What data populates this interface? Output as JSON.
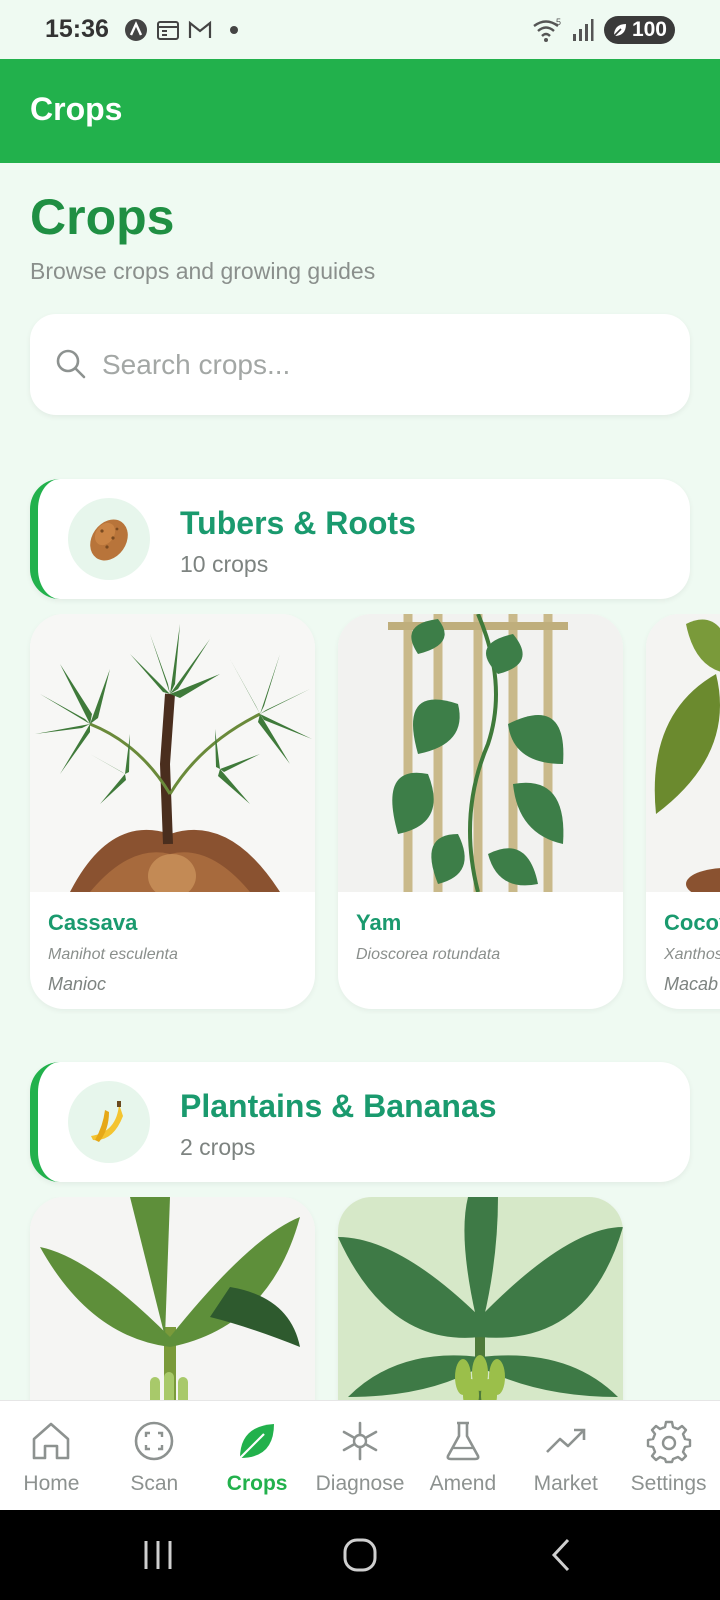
{
  "status_bar": {
    "time": "15:36",
    "wifi_label": "5",
    "battery": "100",
    "icons": [
      "app-a-icon",
      "calendar-icon",
      "gmail-icon",
      "notification-dot-icon",
      "wifi-icon",
      "signal-icon",
      "battery-icon"
    ]
  },
  "app_bar": {
    "title": "Crops"
  },
  "header": {
    "title": "Crops",
    "subtitle": "Browse crops and growing guides"
  },
  "search": {
    "placeholder": "Search crops...",
    "value": ""
  },
  "categories": [
    {
      "name": "Tubers & Roots",
      "count": "10 crops",
      "icon": "potato-icon",
      "crops": [
        {
          "name": "Cassava",
          "scientific": "Manihot esculenta",
          "local": "Manioc"
        },
        {
          "name": "Yam",
          "scientific": "Dioscorea rotundata",
          "local": ""
        },
        {
          "name": "Cocoy",
          "scientific": "Xanthos",
          "local": "Macab"
        }
      ]
    },
    {
      "name": "Plantains & Bananas",
      "count": "2 crops",
      "icon": "banana-icon",
      "crops": []
    }
  ],
  "bottom_nav": {
    "items": [
      {
        "label": "Home",
        "icon": "home-icon",
        "active": false
      },
      {
        "label": "Scan",
        "icon": "scan-icon",
        "active": false
      },
      {
        "label": "Crops",
        "icon": "leaf-icon",
        "active": true
      },
      {
        "label": "Diagnose",
        "icon": "diagnose-icon",
        "active": false
      },
      {
        "label": "Amend",
        "icon": "flask-icon",
        "active": false
      },
      {
        "label": "Market",
        "icon": "trend-icon",
        "active": false
      },
      {
        "label": "Settings",
        "icon": "gear-icon",
        "active": false
      }
    ]
  },
  "colors": {
    "primary": "#22b14c",
    "title_green": "#1f8f43",
    "crop_name": "#1a9a6e",
    "background": "#effaf2"
  }
}
